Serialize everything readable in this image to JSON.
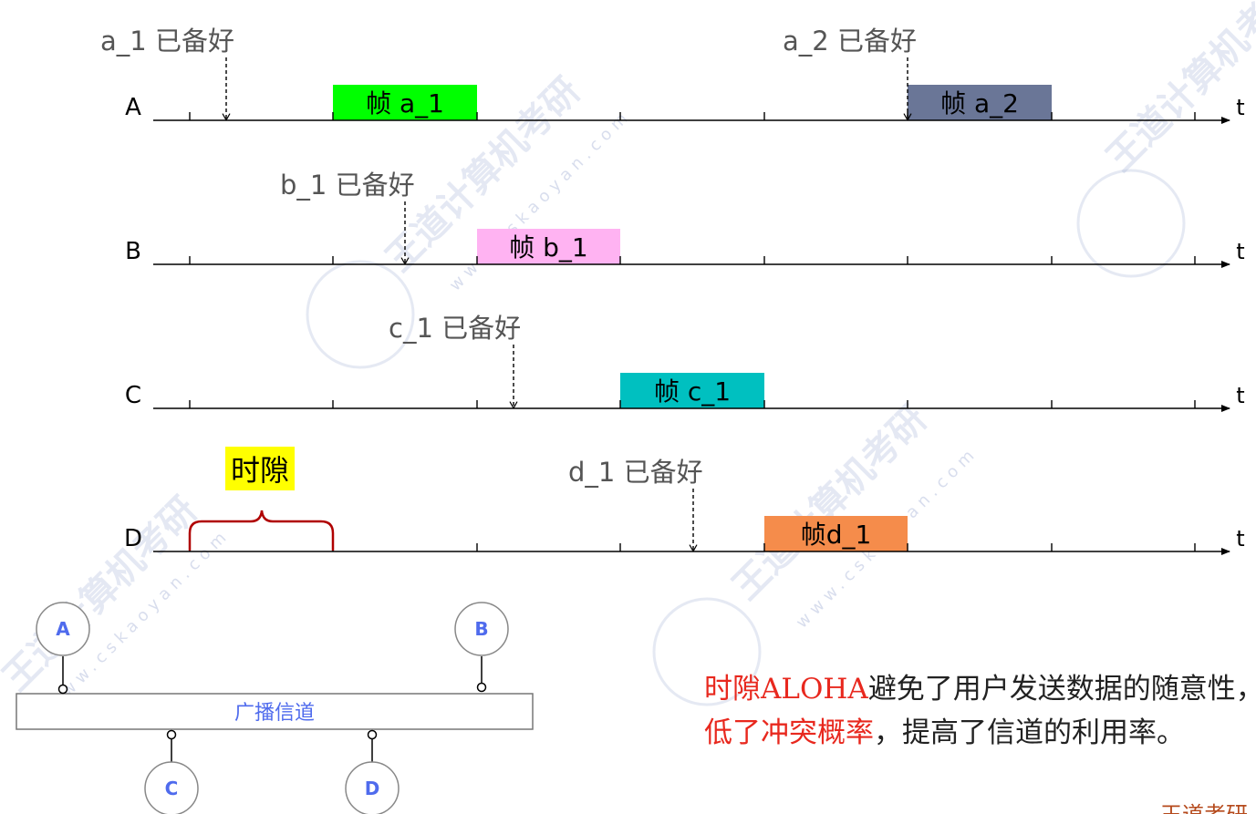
{
  "timeline": {
    "axis_label": "t",
    "rows": [
      {
        "label": "A",
        "ready_label": "a_1 已备好",
        "frames": [
          {
            "label": "帧 a_1",
            "color": "#00ff00"
          },
          {
            "label": "帧 a_2",
            "color": "#6a7697"
          }
        ],
        "ready_events": [
          {
            "label": "a_1 已备好"
          },
          {
            "label": "a_2 已备好"
          }
        ]
      },
      {
        "label": "B",
        "frames": [
          {
            "label": "帧 b_1",
            "color": "#ffb3f2"
          }
        ],
        "ready_events": [
          {
            "label": "b_1 已备好"
          }
        ]
      },
      {
        "label": "C",
        "frames": [
          {
            "label": "帧 c_1",
            "color": "#00c0c0"
          }
        ],
        "ready_events": [
          {
            "label": "c_1 已备好"
          }
        ]
      },
      {
        "label": "D",
        "frames": [
          {
            "label": "帧d_1",
            "color": "#f58c4b"
          }
        ],
        "ready_events": [
          {
            "label": "d_1 已备好"
          }
        ]
      }
    ],
    "slot_label": "时隙",
    "slot_label_bg": "#ffff00",
    "brace_color": "#b00000"
  },
  "network": {
    "channel_label": "广播信道",
    "nodes": [
      "A",
      "B",
      "C",
      "D"
    ],
    "accent": "#4f6bed"
  },
  "summary": {
    "line1_red": "时隙ALOHA",
    "line1_black": "避免了用户发送数据的随意性，降",
    "line2_red": "低了冲突概率",
    "line2_black": "，提高了信道的利用率。"
  },
  "publisher": "王道考研",
  "watermark": {
    "brand": "王道计算机考研",
    "url": "www.cskaoyan.com"
  }
}
